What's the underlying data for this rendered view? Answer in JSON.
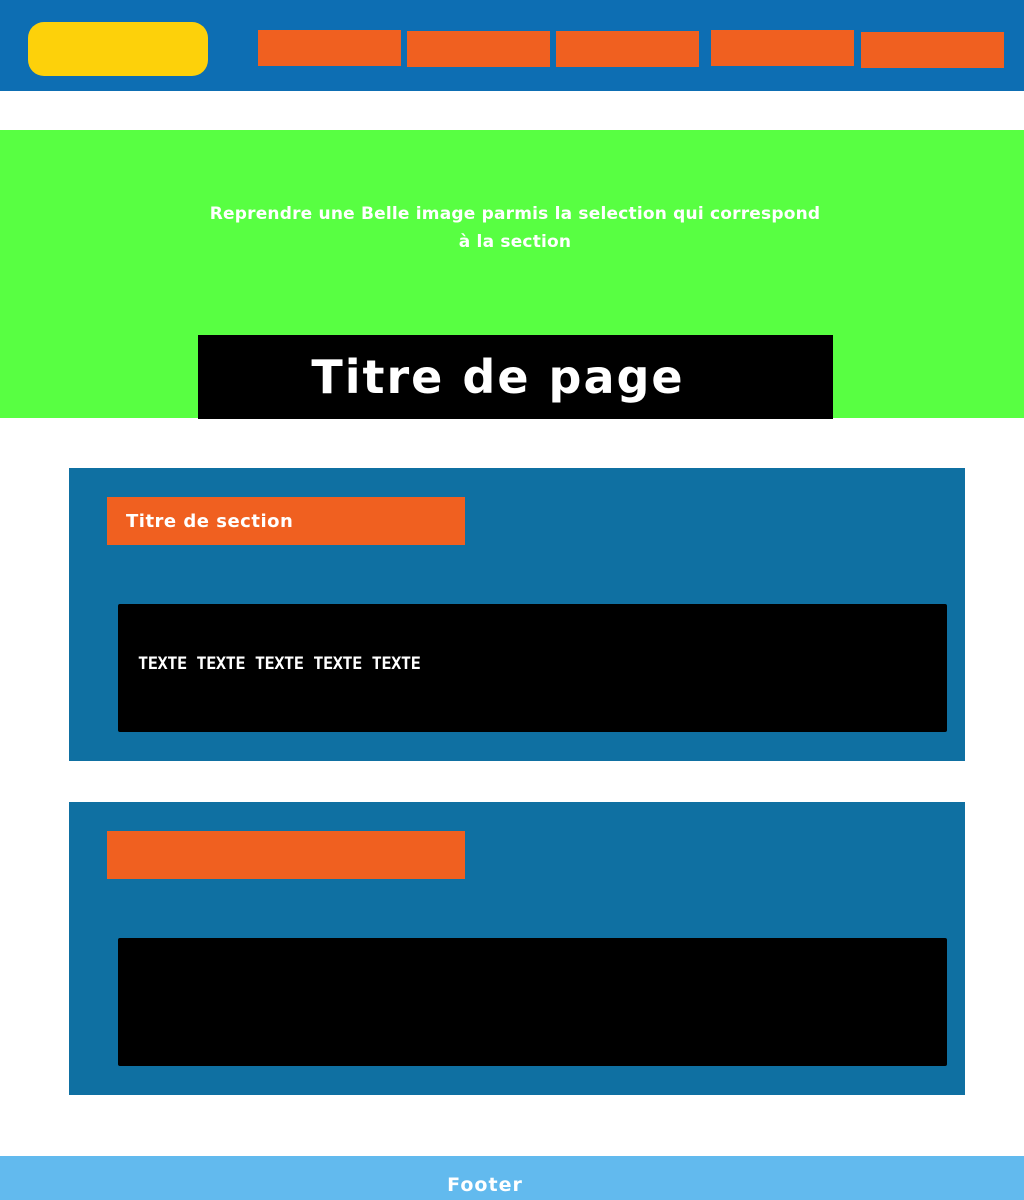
{
  "header": {
    "logo": "",
    "nav": [
      "",
      "",
      "",
      "",
      ""
    ]
  },
  "hero": {
    "note_line1": "Reprendre une Belle image parmis la selection qui correspond",
    "note_line2": "à la section",
    "title": "Titre de page"
  },
  "sections": [
    {
      "title": "Titre de section",
      "text": "TEXTE TEXTE TEXTE TEXTE TEXTE"
    },
    {
      "title": "",
      "text": ""
    }
  ],
  "footer": {
    "label": "Footer"
  },
  "colors": {
    "header_bg": "#0d6eb3",
    "logo": "#fdd10a",
    "nav_item": "#f06020",
    "hero_bg": "#58ff42",
    "title_box": "#000000",
    "section_bg": "#0f70a2",
    "section_title_bg": "#f06020",
    "footer_bg": "#62baee"
  }
}
